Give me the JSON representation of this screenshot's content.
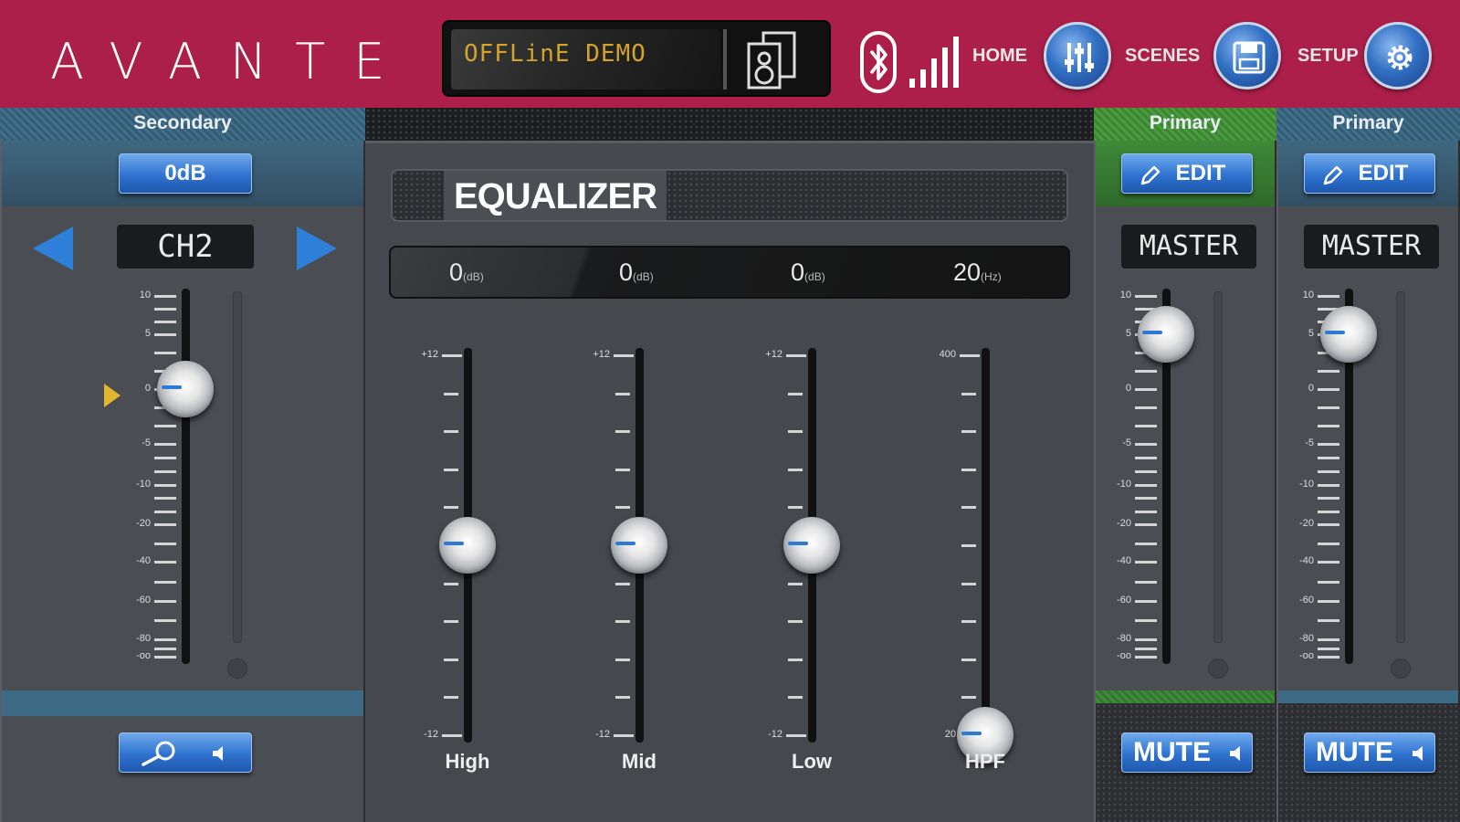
{
  "header": {
    "brand": "AVANTE",
    "status_text": "OFFLinE DEMO",
    "nav": {
      "home_label": "HOME",
      "scenes_label": "SCENES",
      "setup_label": "SETUP"
    }
  },
  "secondary": {
    "section_label": "Secondary",
    "gain_button": "0dB",
    "channel_name": "CH2",
    "scale": [
      "10",
      "5",
      "0",
      "-5",
      "-10",
      "-20",
      "-40",
      "-60",
      "-80",
      "-oo"
    ]
  },
  "equalizer": {
    "title": "EQUALIZER",
    "values": [
      {
        "value": "0",
        "unit": "(dB)"
      },
      {
        "value": "0",
        "unit": "(dB)"
      },
      {
        "value": "0",
        "unit": "(dB)"
      },
      {
        "value": "20",
        "unit": "(Hz)"
      }
    ],
    "bands": [
      {
        "name": "High",
        "top": "+12",
        "bottom": "-12",
        "level": 0.5
      },
      {
        "name": "Mid",
        "top": "+12",
        "bottom": "-12",
        "level": 0.5
      },
      {
        "name": "Low",
        "top": "+12",
        "bottom": "-12",
        "level": 0.5
      },
      {
        "name": "HPF",
        "top": "400",
        "bottom": "20",
        "level": 0
      }
    ]
  },
  "primary_1": {
    "section_label": "Primary",
    "edit_button": "EDIT",
    "channel_name": "MASTER",
    "mute_button": "MUTE",
    "scale": [
      "10",
      "5",
      "0",
      "-5",
      "-10",
      "-20",
      "-40",
      "-60",
      "-80",
      "-oo"
    ]
  },
  "primary_2": {
    "section_label": "Primary",
    "edit_button": "EDIT",
    "channel_name": "MASTER",
    "mute_button": "MUTE",
    "scale": [
      "10",
      "5",
      "0",
      "-5",
      "-10",
      "-20",
      "-40",
      "-60",
      "-80",
      "-oo"
    ]
  },
  "colors": {
    "header_bg": "#ad1f4b",
    "status_text": "#d3a42c",
    "button_blue": "#2f73cf",
    "primary_green": "#3f8a38",
    "secondary_blue": "#416e8a"
  }
}
